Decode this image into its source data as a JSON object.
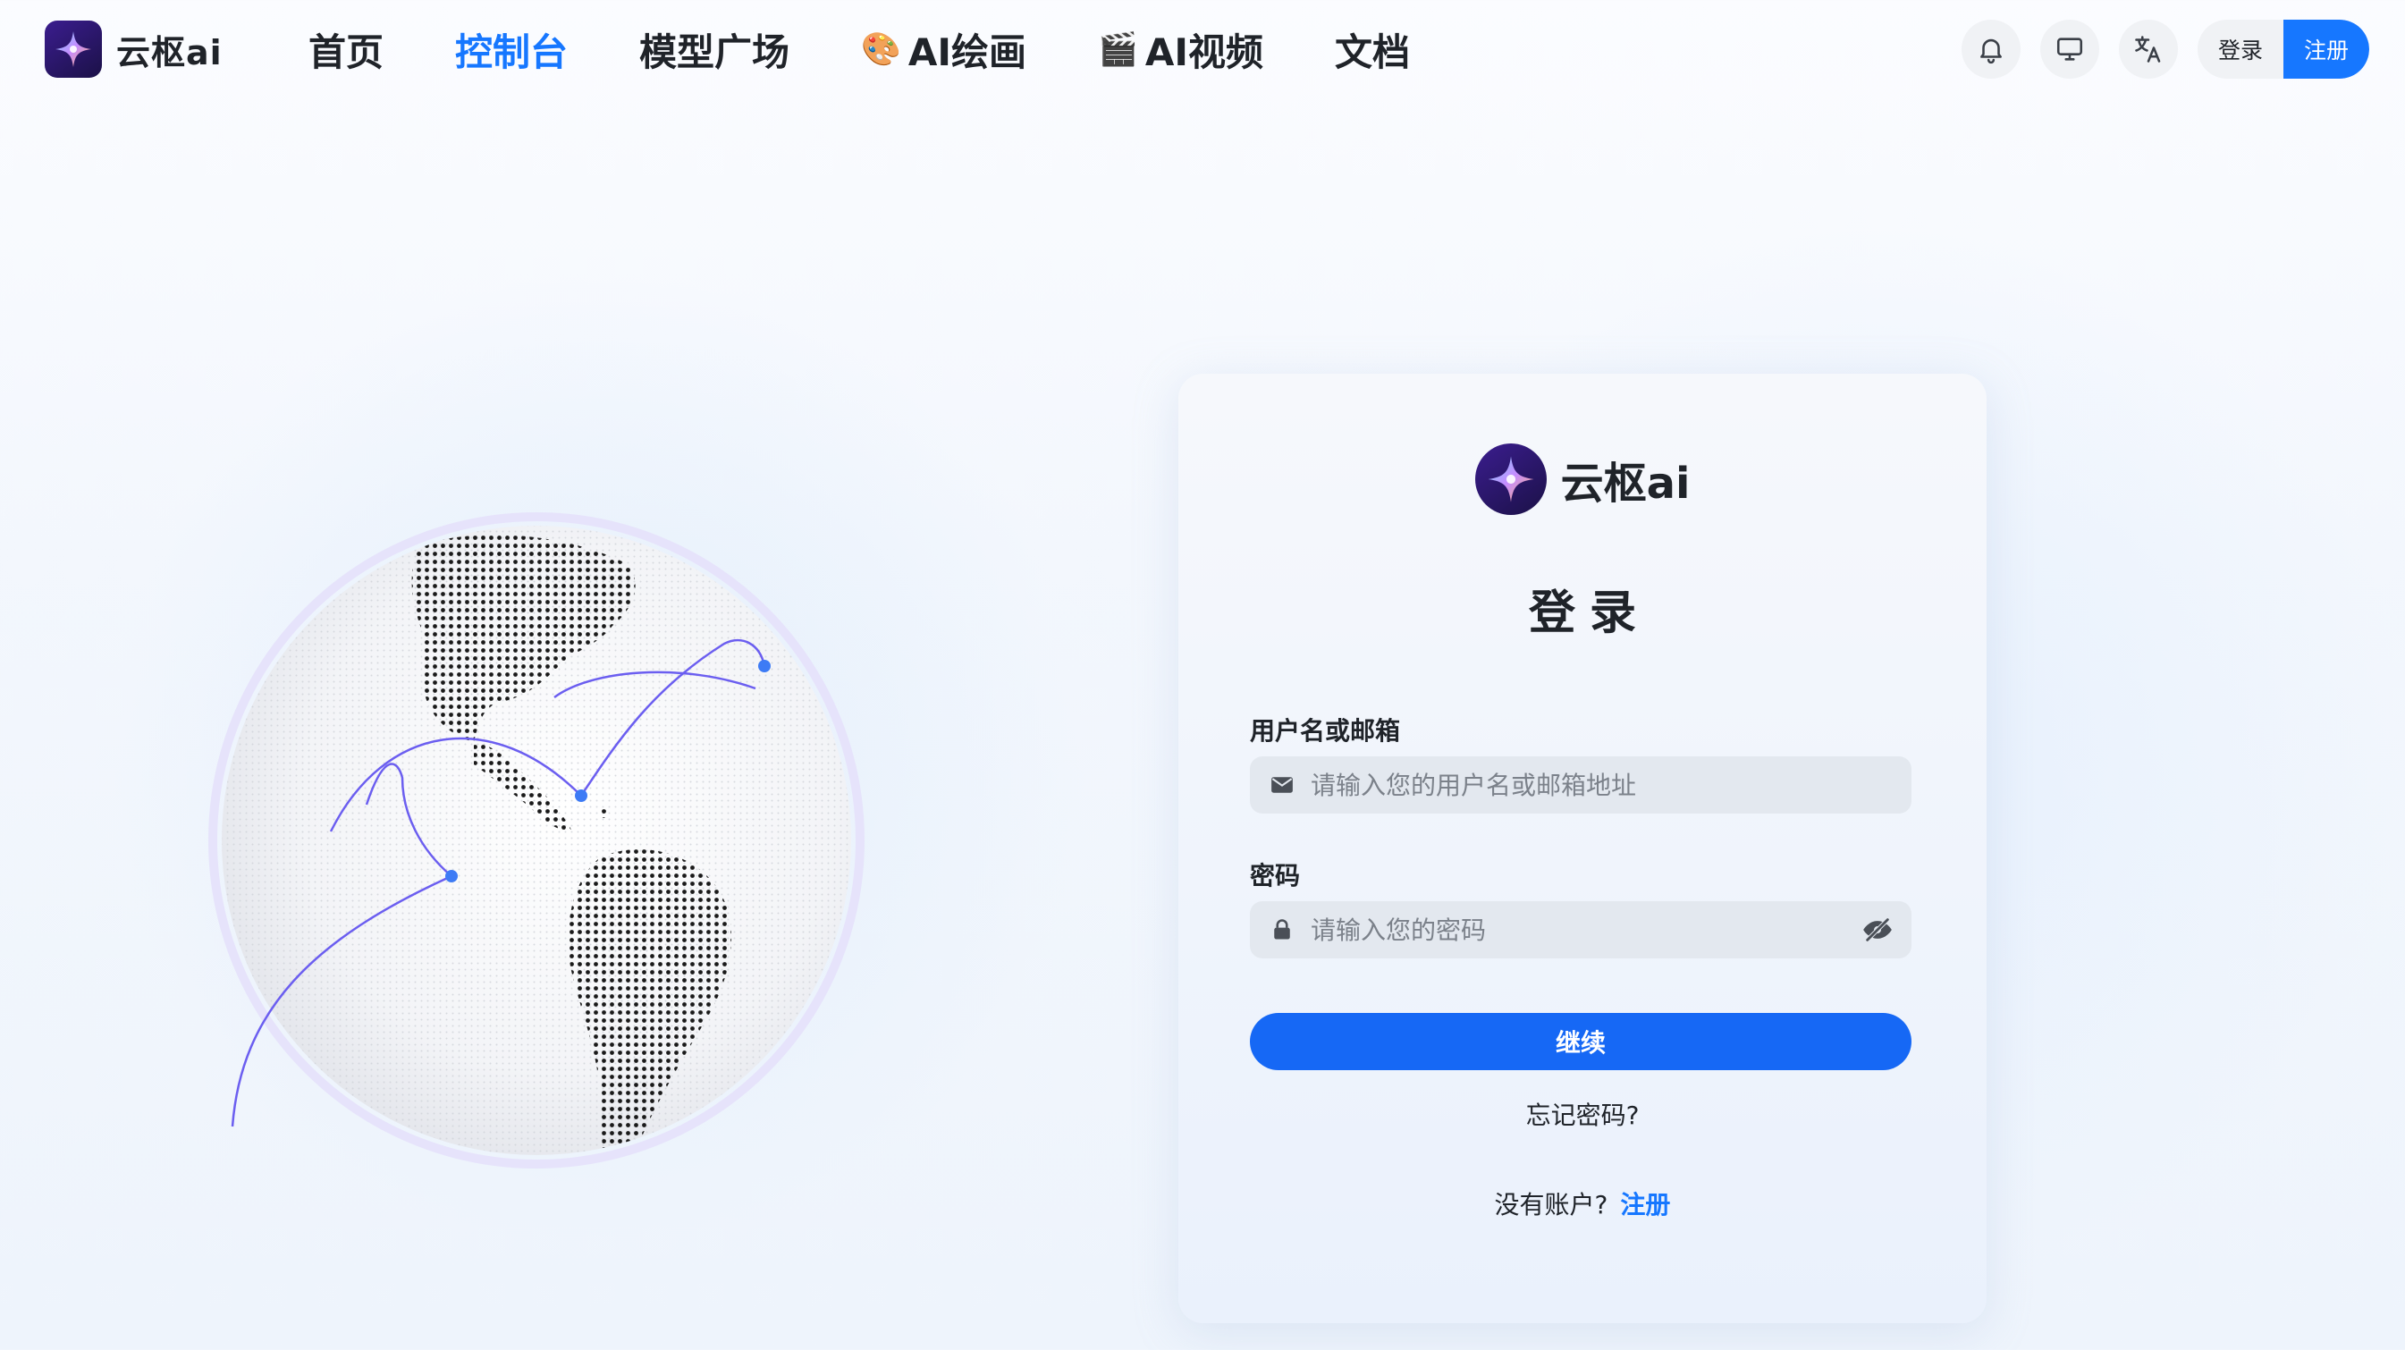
{
  "brand": {
    "name": "云枢ai",
    "accent_color": "#1677ff",
    "logo_icon": "sparkle-star-icon"
  },
  "nav": {
    "links": [
      {
        "label": "首页",
        "active": false
      },
      {
        "label": "控制台",
        "active": true
      },
      {
        "label": "模型广场",
        "active": false
      },
      {
        "label": "AI绘画",
        "emoji": "🎨",
        "active": false
      },
      {
        "label": "AI视频",
        "emoji": "🎬",
        "active": false
      },
      {
        "label": "文档",
        "active": false
      }
    ],
    "icons": [
      "bell-icon",
      "monitor-icon",
      "translate-icon"
    ],
    "login_label": "登录",
    "register_label": "注册"
  },
  "login_card": {
    "brand_name": "云枢ai",
    "title": "登录",
    "username": {
      "label": "用户名或邮箱",
      "placeholder": "请输入您的用户名或邮箱地址",
      "value": "",
      "icon": "mail-icon"
    },
    "password": {
      "label": "密码",
      "placeholder": "请输入您的密码",
      "value": "",
      "icon": "lock-icon",
      "toggle_icon": "eye-off-icon"
    },
    "continue_label": "继续",
    "forgot_label": "忘记密码?",
    "no_account_text": "没有账户?",
    "signup_label": "注册"
  }
}
